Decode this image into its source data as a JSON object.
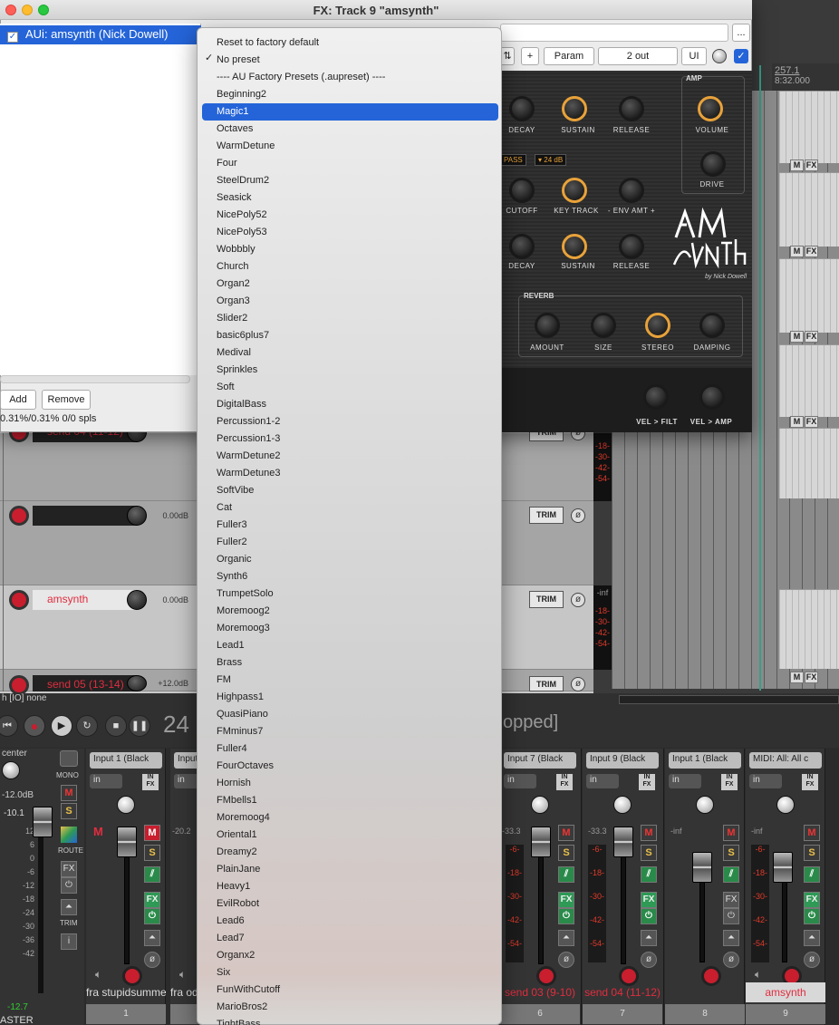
{
  "window": {
    "title": "FX: Track 9 \"amsynth\""
  },
  "fx_list": {
    "selected_item": "AUi: amsynth (Nick Dowell)",
    "add_label": "Add",
    "remove_label": "Remove",
    "cpu_status": "0.31%/0.31% 0/0 spls"
  },
  "plugin_toolbar": {
    "plus_label": "+",
    "param_label": "Param",
    "io_label": "2 out",
    "ui_label": "UI",
    "more_label": "..."
  },
  "plugin": {
    "amp_label": "AMP",
    "env1_labels": [
      "DECAY",
      "SUSTAIN",
      "RELEASE"
    ],
    "amp_knobs": [
      "VOLUME",
      "DRIVE"
    ],
    "filter_type": "PASS",
    "filter_slope": "24 dB",
    "filter_labels": [
      "CUTOFF",
      "KEY TRACK",
      "- ENV AMT +"
    ],
    "env2_labels": [
      "DECAY",
      "SUSTAIN",
      "RELEASE"
    ],
    "reverb_label": "REVERB",
    "reverb_knobs": [
      "AMOUNT",
      "SIZE",
      "STEREO",
      "DAMPING"
    ],
    "vel_knobs": [
      "VEL > FILT",
      "VEL > AMP"
    ],
    "logo_sub": "by Nick Dowell"
  },
  "menu": {
    "items": [
      {
        "label": "Reset to factory default",
        "checked": false
      },
      {
        "label": "No preset",
        "checked": true
      },
      {
        "label": "----  AU Factory Presets (.aupreset)  ----",
        "checked": false
      }
    ],
    "presets": [
      "Beginning2",
      "Magic1",
      "Octaves",
      "WarmDetune",
      "Four",
      "SteelDrum2",
      "Seasick",
      "NicePoly52",
      "NicePoly53",
      "Wobbbly",
      "Church",
      "Organ2",
      "Organ3",
      "Slider2",
      "basic6plus7",
      "Medival",
      "Sprinkles",
      "Soft",
      "DigitalBass",
      "Percussion1-2",
      "Percussion1-3",
      "WarmDetune2",
      "WarmDetune3",
      "SoftVibe",
      "Cat",
      "Fuller3",
      "Fuller2",
      "Organic",
      "Synth6",
      "TrumpetSolo",
      "Moremoog2",
      "Moremoog3",
      "Lead1",
      "Brass",
      "FM",
      "Highpass1",
      "QuasiPiano",
      "FMminus7",
      "Fuller4",
      "FourOctaves",
      "Hornish",
      "FMbells1",
      "Moremoog4",
      "Oriental1",
      "Dreamy2",
      "PlainJane",
      "Heavy1",
      "EvilRobot",
      "Lead6",
      "Lead7",
      "Organx2",
      "Six",
      "FunWithCutoff",
      "MarioBros2",
      "TightBass"
    ],
    "highlighted": "Magic1"
  },
  "timeline": {
    "ruler_bar": "257.1",
    "ruler_time": "8:32.000",
    "btn_labels": [
      "M",
      "FX"
    ]
  },
  "tracks": [
    {
      "name": "send 04 (11-12)",
      "db": ""
    },
    {
      "name": "",
      "db": "0.00dB"
    },
    {
      "name": "amsynth",
      "db": "0.00dB"
    },
    {
      "name": "send 05 (13-14)",
      "db": "+12.0dB"
    }
  ],
  "track_meter_labels": [
    "-18-",
    "-30-",
    "-42-",
    "-54-",
    "-inf"
  ],
  "trim_label": "TRIM",
  "transport": {
    "status": "h [IO] none",
    "time": "24",
    "state": "opped]"
  },
  "master": {
    "center_label": "center",
    "db_label": "-12.0dB",
    "peak": "-10.1",
    "bottom_value": "-12.7",
    "name": "ASTER",
    "scale": [
      "12",
      "6",
      "0",
      "-6",
      "-12",
      "-18",
      "-24",
      "-30",
      "-36",
      "-42"
    ],
    "mono": "MONO",
    "route": "ROUTE",
    "trim": "TRIM"
  },
  "mixer_strips": [
    {
      "input": "Input 1 (Black",
      "name": "fra stupidsummer",
      "num": "1",
      "peak": "",
      "scale": []
    },
    {
      "input": "Input",
      "name": "fra od",
      "num": "",
      "peak": "-20.2",
      "scale": []
    },
    {
      "input": "Input 7 (Black",
      "name": "send 03 (9-10)",
      "num": "6",
      "peak": "-33.3",
      "scale": [
        "-6-",
        "-18-",
        "-30-",
        "-42-",
        "-54-"
      ]
    },
    {
      "input": "Input 9 (Black",
      "name": "send 04 (11-12)",
      "num": "7",
      "peak": "-33.3",
      "scale": [
        "-6-",
        "-18-",
        "-30-",
        "-42-",
        "-54-"
      ]
    },
    {
      "input": "Input 1 (Black",
      "name": "",
      "num": "8",
      "peak": "-inf",
      "scale": []
    },
    {
      "input": "MIDI: All: All c",
      "name": "amsynth",
      "num": "9",
      "peak": "-inf",
      "scale": [
        "-6-",
        "-18-",
        "-30-",
        "-42-",
        "-54-"
      ]
    }
  ],
  "mixer_labels": {
    "in": "in",
    "m": "M",
    "s": "S",
    "fx": "FX"
  },
  "colors": {
    "accent": "#2464d8",
    "record": "#c81e2e",
    "knob_gold": "#e8a23a",
    "meter_red": "#e03a2a"
  }
}
